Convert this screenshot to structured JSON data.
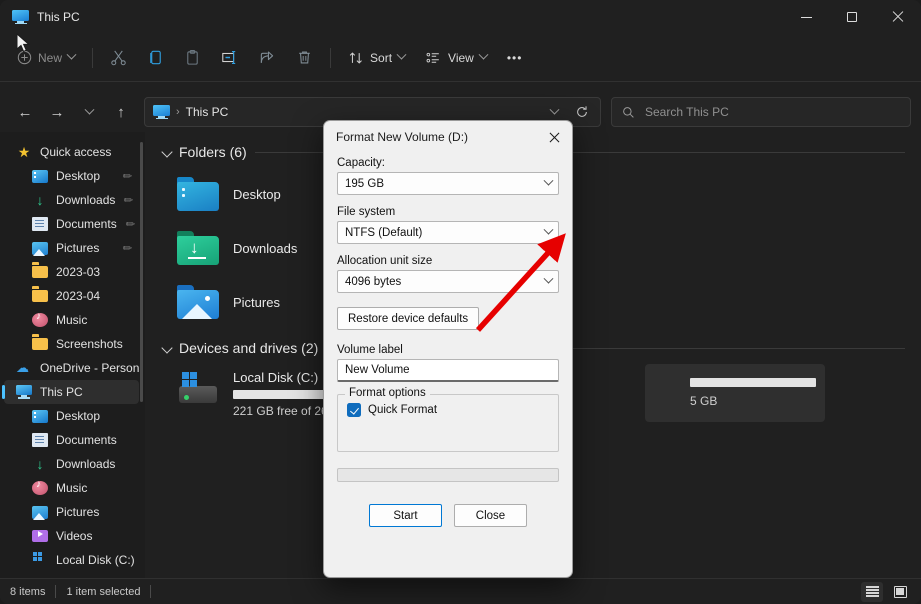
{
  "window": {
    "title": "This PC",
    "icon": "this-pc-icon",
    "controls": {
      "minimize": "—",
      "maximize": "□",
      "close": "✕"
    }
  },
  "toolbar": {
    "new_label": "New",
    "sort_label": "Sort",
    "view_label": "View",
    "more_label": "•••",
    "icons": [
      "cut-icon",
      "copy-icon",
      "paste-icon",
      "rename-icon",
      "share-icon",
      "delete-icon"
    ]
  },
  "address": {
    "back": "←",
    "forward": "→",
    "recent": "⌄",
    "up": "↑",
    "crumb_icon": "this-pc-icon",
    "crumb_sep": "›",
    "crumb_label": "This PC",
    "dropdown": "⌄",
    "refresh": "↻"
  },
  "search": {
    "icon": "search-icon",
    "placeholder": "Search This PC"
  },
  "sidebar": {
    "items": [
      {
        "label": "Quick access",
        "icon": "star-icon",
        "indent": false,
        "pinned": false,
        "selected": false
      },
      {
        "label": "Desktop",
        "icon": "desktop-icon",
        "indent": true,
        "pinned": true,
        "selected": false
      },
      {
        "label": "Downloads",
        "icon": "downloads-icon",
        "indent": true,
        "pinned": true,
        "selected": false
      },
      {
        "label": "Documents",
        "icon": "documents-icon",
        "indent": true,
        "pinned": true,
        "selected": false
      },
      {
        "label": "Pictures",
        "icon": "pictures-icon",
        "indent": true,
        "pinned": true,
        "selected": false
      },
      {
        "label": "2023-03",
        "icon": "folder-icon",
        "indent": true,
        "pinned": false,
        "selected": false
      },
      {
        "label": "2023-04",
        "icon": "folder-icon",
        "indent": true,
        "pinned": false,
        "selected": false
      },
      {
        "label": "Music",
        "icon": "music-icon",
        "indent": true,
        "pinned": false,
        "selected": false
      },
      {
        "label": "Screenshots",
        "icon": "folder-icon",
        "indent": true,
        "pinned": false,
        "selected": false
      },
      {
        "label": "OneDrive - Person",
        "icon": "cloud-icon",
        "indent": false,
        "pinned": false,
        "selected": false
      },
      {
        "label": "This PC",
        "icon": "this-pc-icon",
        "indent": false,
        "pinned": false,
        "selected": true
      },
      {
        "label": "Desktop",
        "icon": "desktop-icon",
        "indent": true,
        "pinned": false,
        "selected": false
      },
      {
        "label": "Documents",
        "icon": "documents-icon",
        "indent": true,
        "pinned": false,
        "selected": false
      },
      {
        "label": "Downloads",
        "icon": "downloads-icon",
        "indent": true,
        "pinned": false,
        "selected": false
      },
      {
        "label": "Music",
        "icon": "music-icon",
        "indent": true,
        "pinned": false,
        "selected": false
      },
      {
        "label": "Pictures",
        "icon": "pictures-icon",
        "indent": true,
        "pinned": false,
        "selected": false
      },
      {
        "label": "Videos",
        "icon": "videos-icon",
        "indent": true,
        "pinned": false,
        "selected": false
      },
      {
        "label": "Local Disk (C:)",
        "icon": "disk-icon",
        "indent": true,
        "pinned": false,
        "selected": false
      }
    ]
  },
  "content": {
    "folders_group": "Folders (6)",
    "folders": [
      {
        "name": "Desktop",
        "icon": "folder-desktop-icon"
      },
      {
        "name": "Downloads",
        "icon": "folder-downloads-icon"
      },
      {
        "name": "Pictures",
        "icon": "folder-pictures-icon"
      }
    ],
    "drives_group": "Devices and drives (2)",
    "drives": [
      {
        "name": "Local Disk (C:)",
        "usage_text": "221 GB free of 269",
        "fill_percent": 45
      }
    ],
    "selected_drive": {
      "partial_text": "5 GB"
    }
  },
  "dialog": {
    "title": "Format New Volume (D:)",
    "close_icon": "close-icon",
    "capacity_label": "Capacity:",
    "capacity_value": "195 GB",
    "filesystem_label": "File system",
    "filesystem_value": "NTFS (Default)",
    "allocation_label": "Allocation unit size",
    "allocation_value": "4096 bytes",
    "restore_button": "Restore device defaults",
    "volume_label_label": "Volume label",
    "volume_label_value": "New Volume",
    "format_options_legend": "Format options",
    "quick_format_label": "Quick Format",
    "quick_format_checked": true,
    "start_button": "Start",
    "close_button": "Close"
  },
  "status": {
    "items_count": "8 items",
    "selection": "1 item selected",
    "view_list_icon": "list-view-icon",
    "view_thumb_icon": "thumbnail-view-icon"
  },
  "annotation": {
    "arrow_color": "#e60000"
  }
}
